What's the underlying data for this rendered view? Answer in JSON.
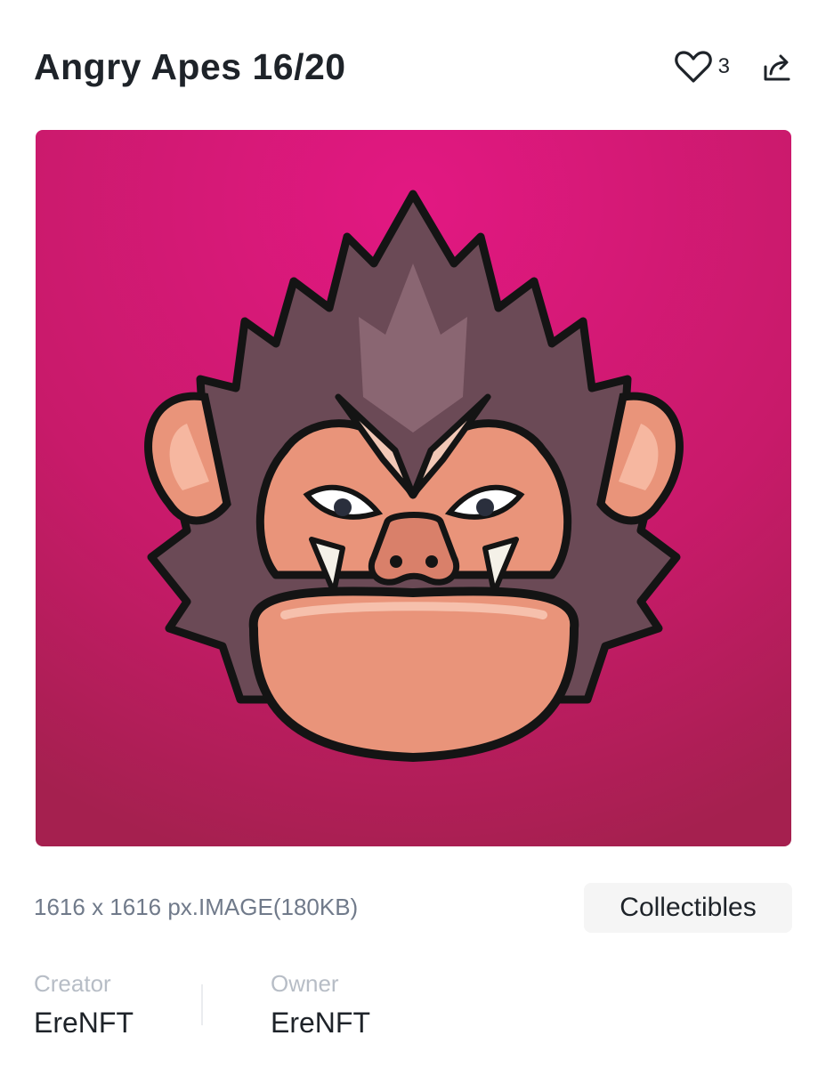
{
  "header": {
    "title": "Angry Apes 16/20",
    "like_count": "3"
  },
  "icons": {
    "like": "heart-icon",
    "share": "share-icon"
  },
  "artwork": {
    "subject": "angry-ape-mascot",
    "background_color": "#d0166f"
  },
  "details": {
    "file_info": "1616 x 1616 px.IMAGE(180KB)",
    "category": "Collectibles"
  },
  "people": {
    "creator": {
      "label": "Creator",
      "name": "EreNFT"
    },
    "owner": {
      "label": "Owner",
      "name": "EreNFT"
    }
  }
}
